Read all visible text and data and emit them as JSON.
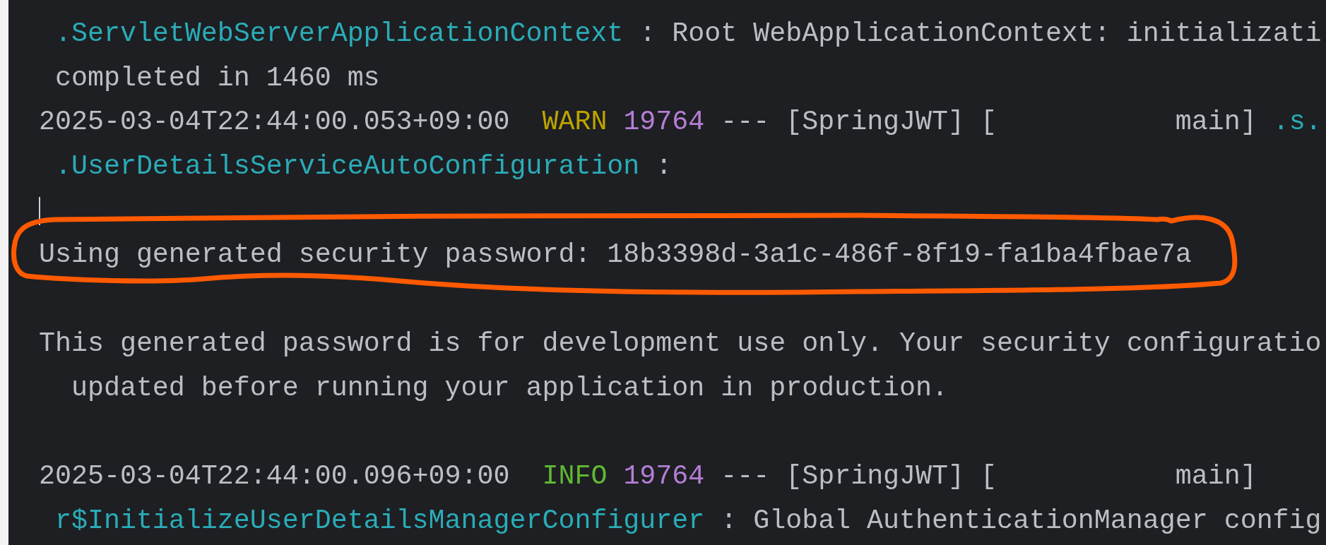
{
  "console": {
    "lines": [
      {
        "kind": "logger-wrap",
        "logger": ".ServletWebServerApplicationContext",
        "separator": ":",
        "message": "Root WebApplicationContext: initializati"
      },
      {
        "kind": "logger-wrap",
        "message": "completed in 1460 ms"
      },
      {
        "kind": "entry",
        "timestamp": "2025-03-04T22:44:00.053+09:00",
        "severity": "WARN",
        "pid": "19764",
        "separator": "---",
        "app": "[SpringJWT]",
        "thread": "[           main]",
        "logger": ".s."
      },
      {
        "kind": "logger-wrap",
        "logger": ".UserDetailsServiceAutoConfiguration",
        "separator": ":"
      },
      {
        "kind": "cursor"
      },
      {
        "kind": "message",
        "message": "Using generated security password: 18b3398d-3a1c-486f-8f19-fa1ba4fbae7a",
        "highlighted": true
      },
      {
        "kind": "blank"
      },
      {
        "kind": "message",
        "message": "This generated password is for development use only. Your security configuratio",
        "highlighted": false
      },
      {
        "kind": "message-wrap",
        "message": "updated before running your application in production."
      },
      {
        "kind": "blank"
      },
      {
        "kind": "entry",
        "timestamp": "2025-03-04T22:44:00.096+09:00",
        "severity": "INFO",
        "pid": "19764",
        "separator": "---",
        "app": "[SpringJWT]",
        "thread": "[           main]"
      },
      {
        "kind": "logger-wrap",
        "logger": "r$InitializeUserDetailsManagerConfigurer",
        "separator": ":",
        "message": "Global AuthenticationManager config"
      }
    ]
  }
}
